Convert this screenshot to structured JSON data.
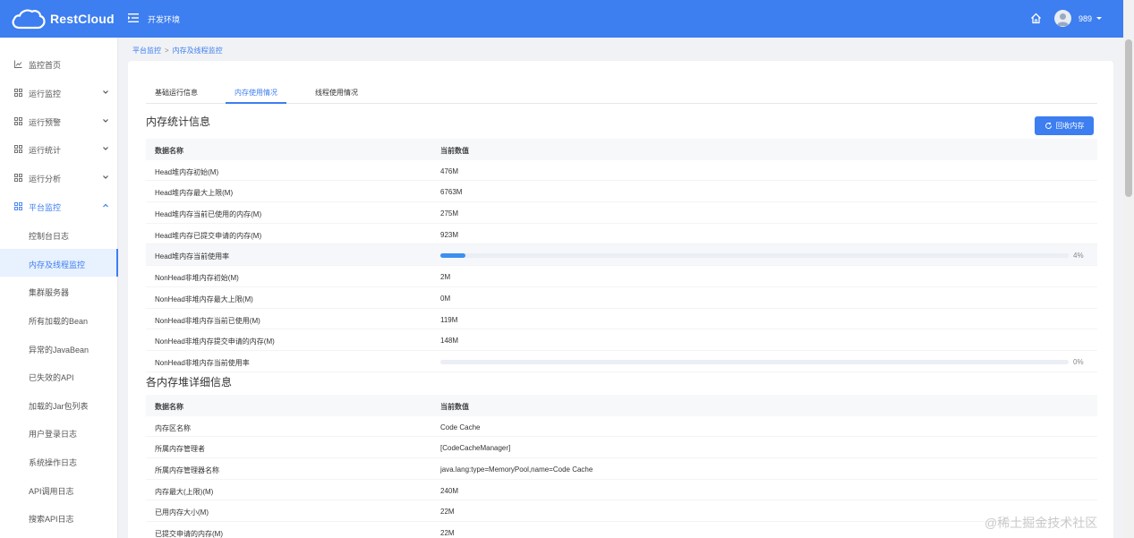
{
  "header": {
    "brand": "RestCloud",
    "env": "开发环境",
    "user": "989"
  },
  "sidebar": {
    "items": [
      {
        "label": "监控首页"
      },
      {
        "label": "运行监控"
      },
      {
        "label": "运行预警"
      },
      {
        "label": "运行统计"
      },
      {
        "label": "运行分析"
      },
      {
        "label": "平台监控"
      }
    ],
    "sub_items": [
      {
        "label": "控制台日志"
      },
      {
        "label": "内存及线程监控"
      },
      {
        "label": "集群服务器"
      },
      {
        "label": "所有加载的Bean"
      },
      {
        "label": "异常的JavaBean"
      },
      {
        "label": "已失效的API"
      },
      {
        "label": "加载的Jar包列表"
      },
      {
        "label": "用户登录日志"
      },
      {
        "label": "系统操作日志"
      },
      {
        "label": "API调用日志"
      },
      {
        "label": "搜索API日志"
      }
    ]
  },
  "breadcrumb": {
    "parent": "平台监控",
    "sep": ">",
    "current": "内存及线程监控"
  },
  "tabs": [
    {
      "label": "基础运行信息"
    },
    {
      "label": "内存使用情况"
    },
    {
      "label": "线程使用情况"
    }
  ],
  "memory_stats": {
    "title": "内存统计信息",
    "reclaim_label": "回收内存",
    "col_name": "数据名称",
    "col_value": "当前数值",
    "rows": [
      {
        "name": "Head堆内存初始(M)",
        "value": "476M"
      },
      {
        "name": "Head堆内存最大上限(M)",
        "value": "6763M"
      },
      {
        "name": "Head堆内存当前已使用的内存(M)",
        "value": "275M"
      },
      {
        "name": "Head堆内存已提交申请的内存(M)",
        "value": "923M"
      },
      {
        "name": "Head堆内存当前使用率",
        "percent": 4,
        "percent_label": "4%"
      },
      {
        "name": "NonHead非堆内存初始(M)",
        "value": "2M"
      },
      {
        "name": "NonHead非堆内存最大上限(M)",
        "value": "0M"
      },
      {
        "name": "NonHead非堆内存当前已使用(M)",
        "value": "119M"
      },
      {
        "name": "NonHead非堆内存提交申请的内存(M)",
        "value": "148M"
      },
      {
        "name": "NonHead非堆内存当前使用率",
        "percent": 0,
        "percent_label": "0%"
      }
    ]
  },
  "heap_details": {
    "title": "各内存堆详细信息",
    "col_name": "数据名称",
    "col_value": "当前数值",
    "rows": [
      {
        "name": "内存区名称",
        "value": "Code Cache"
      },
      {
        "name": "所属内存管理者",
        "value": "[CodeCacheManager]"
      },
      {
        "name": "所属内存管理器名称",
        "value": "java.lang:type=MemoryPool,name=Code Cache"
      },
      {
        "name": "内存最大(上限)(M)",
        "value": "240M"
      },
      {
        "name": "已用内存大小(M)",
        "value": "22M"
      },
      {
        "name": "已提交申请的内存(M)",
        "value": "22M"
      }
    ]
  },
  "watermark": "@稀土掘金技术社区",
  "colors": {
    "primary": "#3d7ef0",
    "background": "#f0f2f5"
  }
}
